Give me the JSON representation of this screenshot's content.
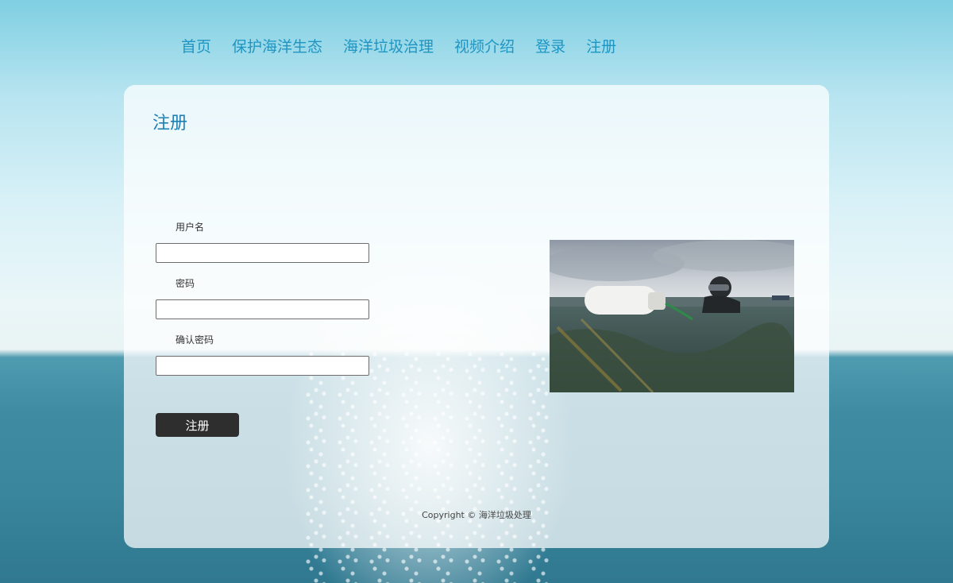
{
  "nav": {
    "items": [
      {
        "label": "首页"
      },
      {
        "label": "保护海洋生态"
      },
      {
        "label": "海洋垃圾治理"
      },
      {
        "label": "视频介绍"
      },
      {
        "label": "登录"
      },
      {
        "label": "注册"
      }
    ]
  },
  "form": {
    "title": "注册",
    "username_label": "用户名",
    "username_value": "",
    "password_label": "密码",
    "password_value": "",
    "confirm_label": "确认密码",
    "confirm_value": "",
    "submit_label": "注册"
  },
  "footer": {
    "copyright": "Copyright © 海洋垃圾处理"
  },
  "colors": {
    "nav_link": "#1f95c2",
    "title": "#1f7fb3",
    "button_bg": "#2e2e2e"
  },
  "icons": {
    "photo": "diver-with-buoy-photo"
  }
}
